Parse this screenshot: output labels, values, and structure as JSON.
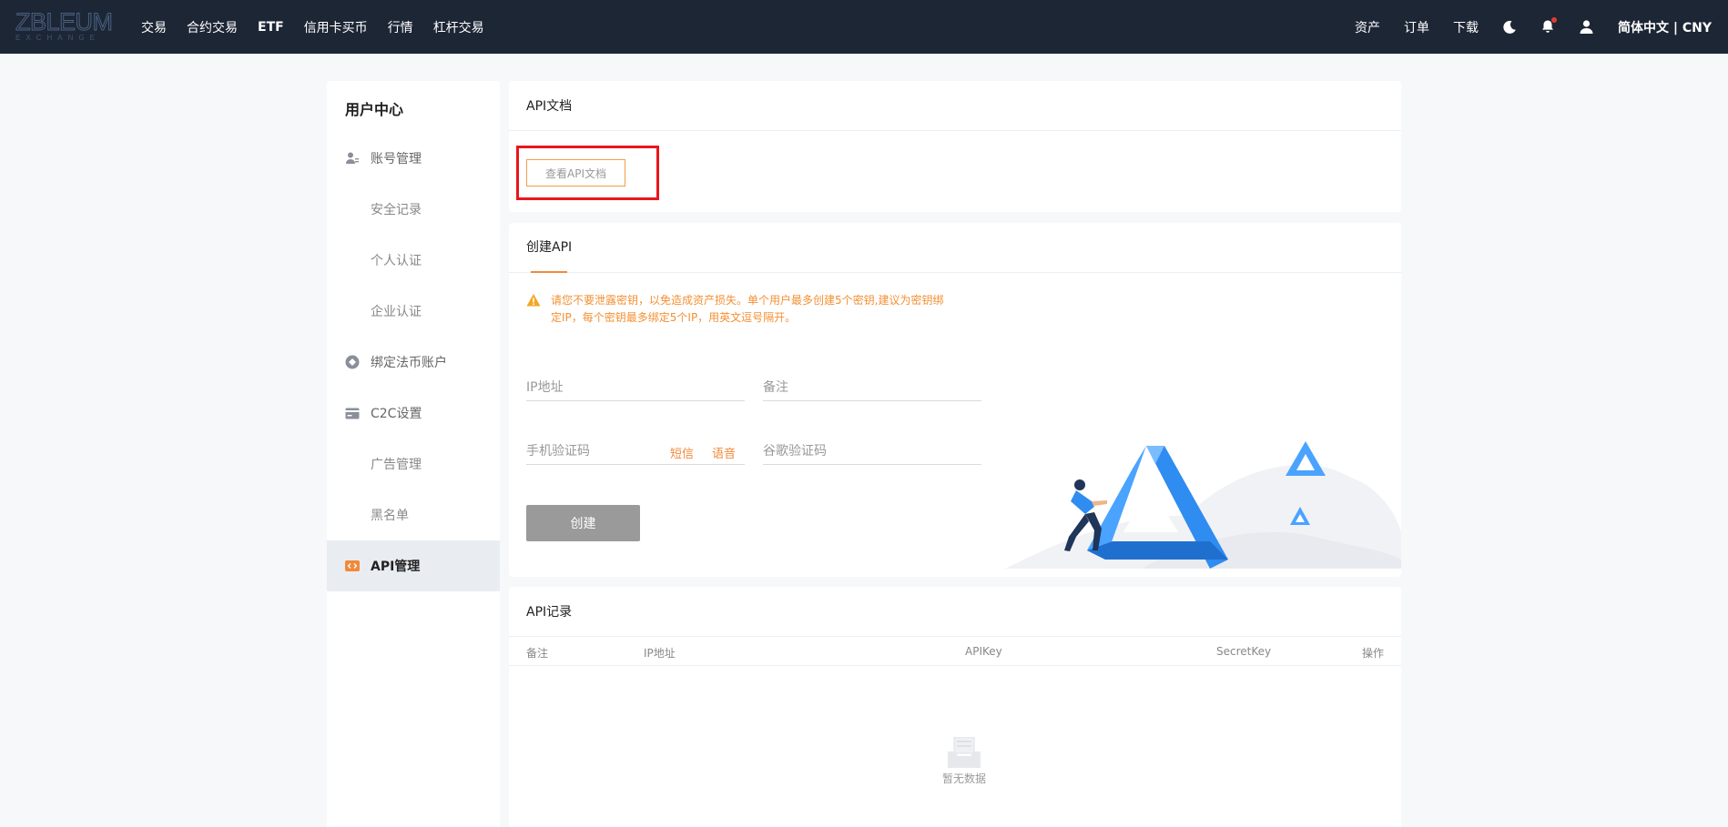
{
  "brand": {
    "name": "ZBLEUM",
    "sub": "EXCHANGE"
  },
  "nav": {
    "items": [
      {
        "label": "交易",
        "bold": false
      },
      {
        "label": "合约交易",
        "bold": false
      },
      {
        "label": "ETF",
        "bold": true
      },
      {
        "label": "信用卡买币",
        "bold": false
      },
      {
        "label": "行情",
        "bold": false
      },
      {
        "label": "杠杆交易",
        "bold": false
      }
    ],
    "right": {
      "assets": "资产",
      "orders": "订单",
      "download": "下载",
      "language": "简体中文 | CNY"
    }
  },
  "sidebar": {
    "title": "用户中心",
    "items": [
      {
        "label": "账号管理",
        "type": "parent",
        "icon": "user-account-icon"
      },
      {
        "label": "安全记录",
        "type": "sub"
      },
      {
        "label": "个人认证",
        "type": "sub"
      },
      {
        "label": "企业认证",
        "type": "sub"
      },
      {
        "label": "绑定法币账户",
        "type": "parent",
        "icon": "fiat-account-icon"
      },
      {
        "label": "C2C设置",
        "type": "parent",
        "icon": "card-icon"
      },
      {
        "label": "广告管理",
        "type": "sub"
      },
      {
        "label": "黑名单",
        "type": "sub"
      },
      {
        "label": "API管理",
        "type": "active",
        "icon": "code-icon"
      }
    ]
  },
  "api_doc": {
    "title": "API文档",
    "button": "查看API文档"
  },
  "create_api": {
    "tab": "创建API",
    "warning": "请您不要泄露密钥，以免造成资产损失。单个用户最多创建5个密钥,建议为密钥绑定IP，每个密钥最多绑定5个IP，用英文逗号隔开。",
    "ip_placeholder": "IP地址",
    "remark_placeholder": "备注",
    "phone_code_placeholder": "手机验证码",
    "sms": "短信",
    "voice": "语音",
    "google_code_placeholder": "谷歌验证码",
    "submit": "创建"
  },
  "api_records": {
    "title": "API记录",
    "columns": [
      "备注",
      "IP地址",
      "APIKey",
      "SecretKey",
      "操作"
    ],
    "empty": "暂无数据"
  },
  "colors": {
    "nav_bg": "#1d2635",
    "accent": "#f08a3b",
    "warning": "#f39033",
    "highlight": "#e8161d",
    "active_bg": "#e9ecf1"
  }
}
